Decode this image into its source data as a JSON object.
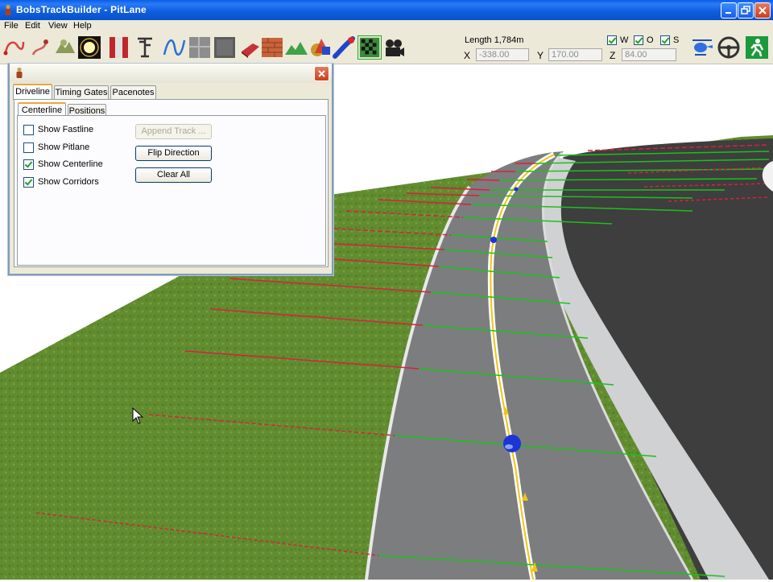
{
  "window": {
    "title": "BobsTrackBuilder - PitLane"
  },
  "menu": [
    "File",
    "Edit",
    "View",
    "Help"
  ],
  "toolbar": {
    "icons": [
      "curve-tool-icon",
      "path-tool-icon",
      "terrain-icon",
      "light-icon",
      "barrier-icon",
      "crane-icon",
      "spline-icon",
      "texture-icon",
      "wall-icon",
      "object-icon",
      "brick-icon",
      "mountain-icon",
      "shapes-icon",
      "tube-icon",
      "checkered-flag-icon",
      "camera-icon"
    ],
    "length_label": "Length 1,784m",
    "x_label": "X",
    "x_value": "-338.00",
    "y_label": "Y",
    "y_value": "170.00",
    "z_label": "Z",
    "z_value": "84.00",
    "toggles": [
      {
        "label": "W",
        "checked": true
      },
      {
        "label": "O",
        "checked": true
      },
      {
        "label": "S",
        "checked": true
      }
    ],
    "right_icons": [
      "helicopter-icon",
      "steering-wheel-icon",
      "exit-icon"
    ]
  },
  "dialog": {
    "tabs": [
      "Driveline",
      "Timing Gates",
      "Pacenotes"
    ],
    "active_tab": "Driveline",
    "subtabs": [
      "Centerline",
      "Positions"
    ],
    "active_subtab": "Centerline",
    "options": [
      {
        "label": "Show Fastline",
        "checked": false
      },
      {
        "label": "Show Pitlane",
        "checked": false
      },
      {
        "label": "Show Centerline",
        "checked": true
      },
      {
        "label": "Show Corridors",
        "checked": true
      }
    ],
    "buttons": {
      "append": "Append Track ...",
      "flip": "Flip Direction",
      "clear": "Clear All"
    }
  },
  "colors": {
    "titlebar": "#0a5ee8",
    "grass": "#5f8a2f",
    "asphalt": "#7d7e80",
    "infield": "#3d3d3d",
    "curb": "#d4d6d8",
    "centerline": "#ffffff",
    "driveline": "#f2c414",
    "corridor_left": "#d8213d",
    "corridor_right": "#19c219",
    "node": "#1b35d6"
  }
}
